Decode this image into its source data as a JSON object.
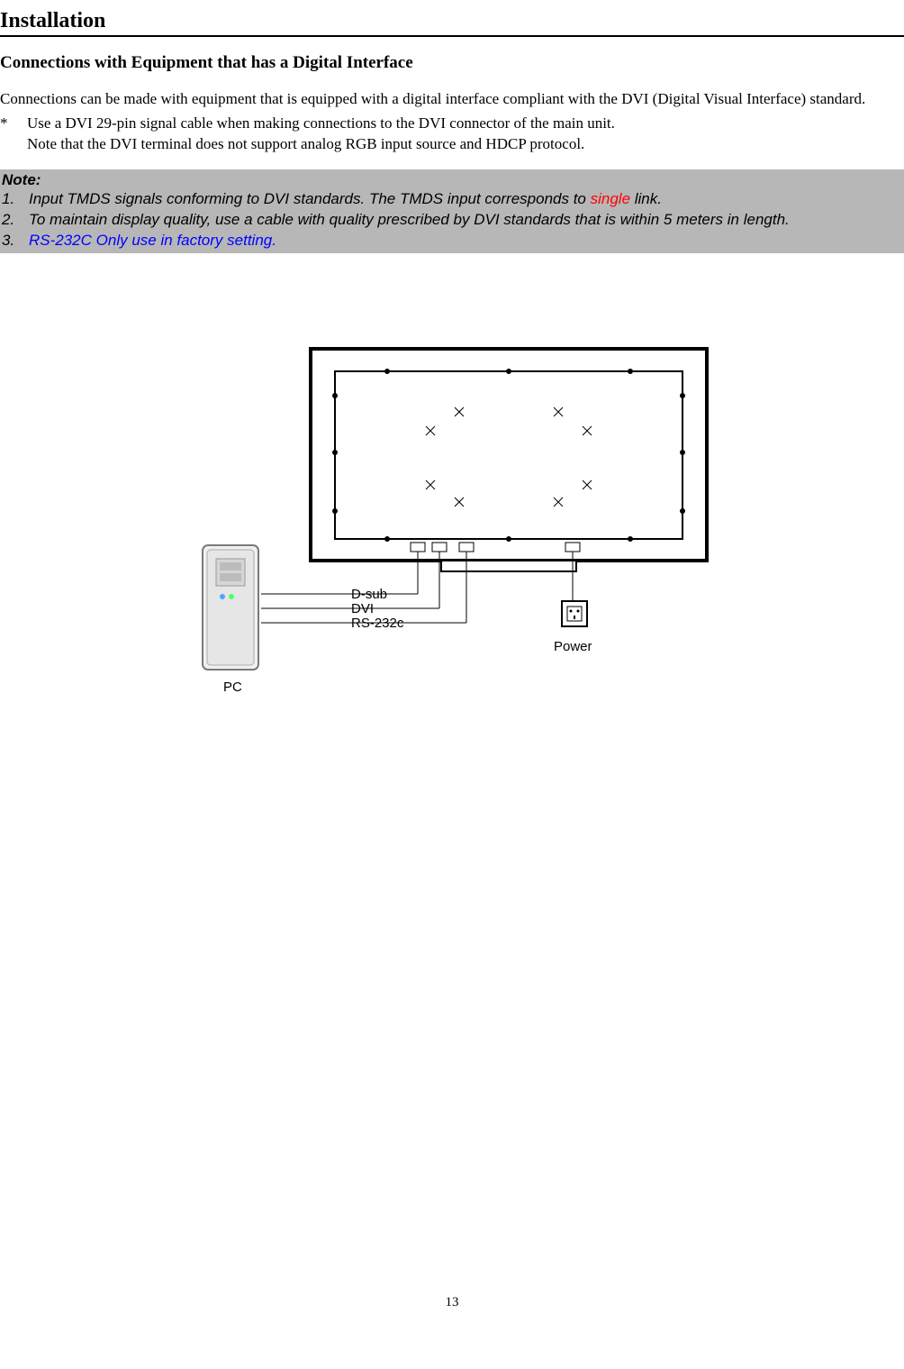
{
  "pageTitle": "Installation",
  "subtitle": "Connections with Equipment that has a Digital Interface",
  "paragraph": "Connections can be made with equipment that is equipped with a digital interface compliant with the DVI (Digital Visual Interface) standard.",
  "bullets": [
    {
      "marker": "*",
      "line1": "Use a DVI 29-pin signal cable when making connections to the DVI connector of the main unit.",
      "line2": "Note that the DVI terminal does not support analog RGB input source and HDCP protocol."
    }
  ],
  "note": {
    "title": "Note:",
    "items": [
      {
        "num": "1.",
        "pre": "Input TMDS signals conforming to DVI standards. The TMDS input corresponds to ",
        "red": "single",
        "post": " link."
      },
      {
        "num": "2.",
        "text": "To maintain display quality, use a cable with quality prescribed by DVI standards that is within 5 meters in length."
      },
      {
        "num": "3.",
        "blue": "RS-232C Only use in factory setting."
      }
    ]
  },
  "diagram": {
    "labels": {
      "dsub": "D-sub",
      "dvi": "DVI",
      "rs232c": "RS-232c",
      "power": "Power",
      "pc": "PC"
    }
  },
  "pageNumber": "13"
}
